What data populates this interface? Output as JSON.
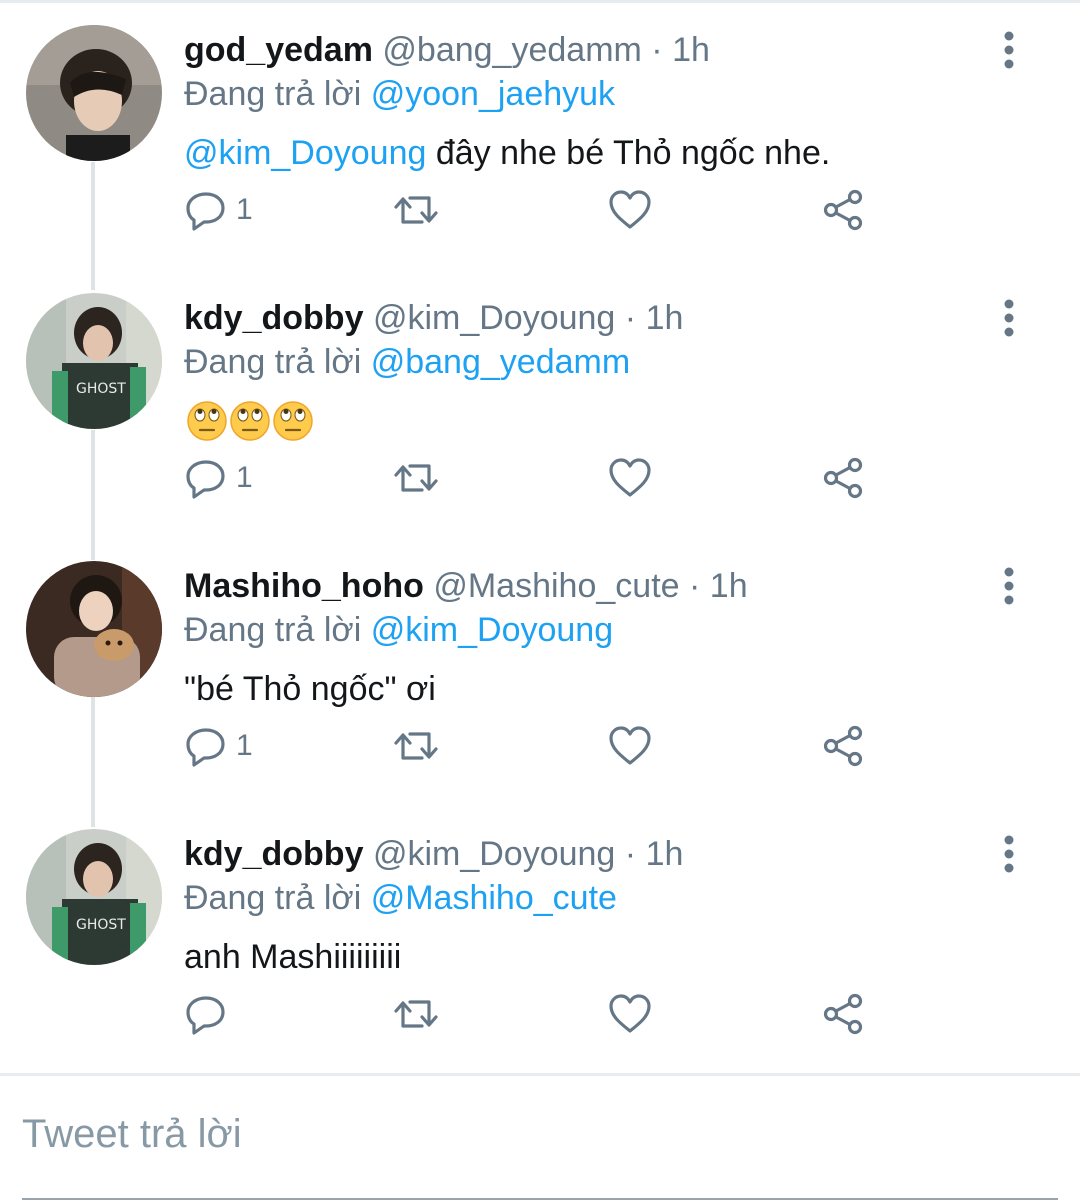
{
  "colors": {
    "accent": "#1da1f2",
    "secondary_text": "#657786",
    "primary_text": "#14171a",
    "divider": "#e6ecf0"
  },
  "tweets": [
    {
      "name": "god_yedam",
      "handle": "@bang_yedamm",
      "separator": "·",
      "time": "1h",
      "reply_prefix": "Đang trả lời",
      "reply_to": "@yoon_jaehyuk",
      "mention": "@kim_Doyoung",
      "text": " đây nhe bé Thỏ ngốc nhe.",
      "reply_count": "1"
    },
    {
      "name": "kdy_dobby",
      "handle": "@kim_Doyoung",
      "separator": "·",
      "time": "1h",
      "reply_prefix": "Đang trả lời",
      "reply_to": "@bang_yedamm",
      "emoji_icon": "face-with-rolling-eyes-emoji",
      "emoji_count": 3,
      "reply_count": "1"
    },
    {
      "name": "Mashiho_hoho",
      "handle": "@Mashiho_cute",
      "separator": "·",
      "time": "1h",
      "reply_prefix": "Đang trả lời",
      "reply_to": "@kim_Doyoung",
      "text": "\"bé Thỏ ngốc\" ơi",
      "reply_count": "1"
    },
    {
      "name": "kdy_dobby",
      "handle": "@kim_Doyoung",
      "separator": "·",
      "time": "1h",
      "reply_prefix": "Đang trả lời",
      "reply_to": "@Mashiho_cute",
      "text": "anh Mashiiiiiiiii",
      "reply_count": ""
    }
  ],
  "icons": {
    "reply": "reply-icon",
    "retweet": "retweet-icon",
    "like": "heart-icon",
    "share": "share-icon",
    "more": "more-vertical-icon"
  },
  "compose": {
    "placeholder": "Tweet trả lời"
  }
}
